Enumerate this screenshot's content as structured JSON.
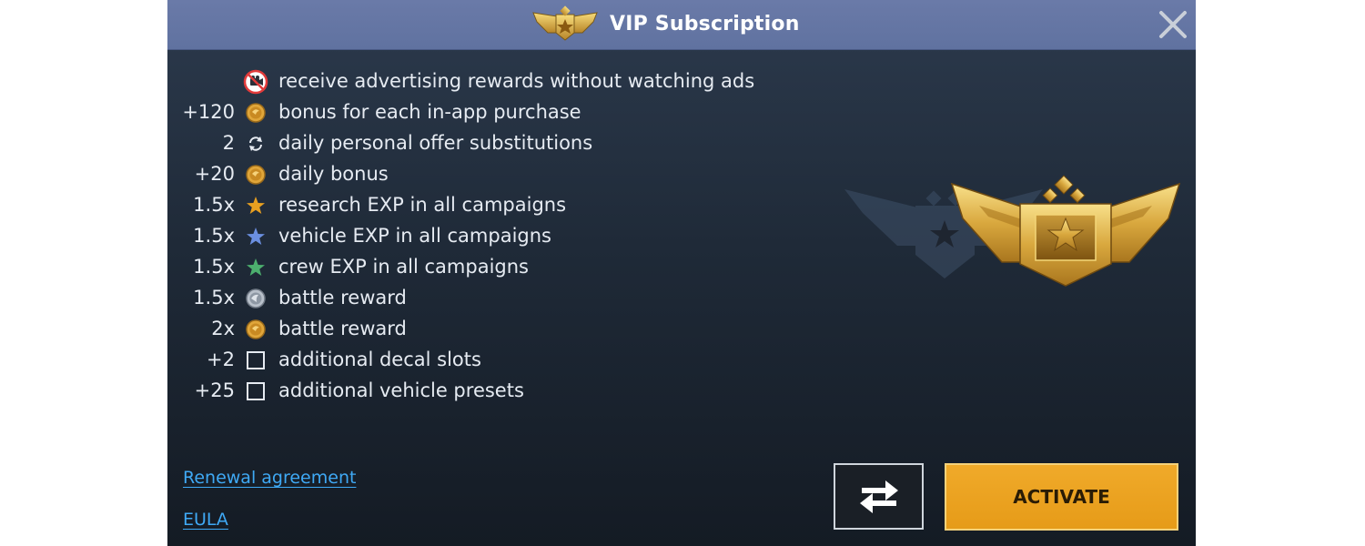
{
  "header": {
    "title": "VIP Subscription"
  },
  "benefits": [
    {
      "amount": "",
      "icon": "no-ads-icon",
      "text": "receive advertising rewards without watching ads"
    },
    {
      "amount": "+120",
      "icon": "gold-coin-icon",
      "text": "bonus for each in-app purchase"
    },
    {
      "amount": "2",
      "icon": "refresh-icon",
      "text": "daily personal offer substitutions"
    },
    {
      "amount": "+20",
      "icon": "gold-coin-icon",
      "text": "daily bonus"
    },
    {
      "amount": "1.5x",
      "icon": "orange-star-icon",
      "text": "research EXP in all campaigns"
    },
    {
      "amount": "1.5x",
      "icon": "blue-star-icon",
      "text": "vehicle EXP in all campaigns"
    },
    {
      "amount": "1.5x",
      "icon": "green-star-icon",
      "text": "crew EXP in all campaigns"
    },
    {
      "amount": "1.5x",
      "icon": "silver-coin-icon",
      "text": "battle reward"
    },
    {
      "amount": "2x",
      "icon": "gold-coin-icon",
      "text": "battle reward"
    },
    {
      "amount": "+2",
      "icon": "checkbox-icon",
      "text": "additional decal slots"
    },
    {
      "amount": "+25",
      "icon": "checkbox-icon",
      "text": "additional vehicle presets"
    }
  ],
  "links": {
    "renewal": "Renewal agreement",
    "eula": "EULA"
  },
  "buttons": {
    "activate": "ACTIVATE"
  },
  "colors": {
    "header": "#6072a0",
    "accent_gold": "#e69b18",
    "link": "#3fa9f5",
    "star_orange": "#e8a020",
    "star_blue": "#6b8fe0",
    "star_green": "#4caf6e"
  }
}
